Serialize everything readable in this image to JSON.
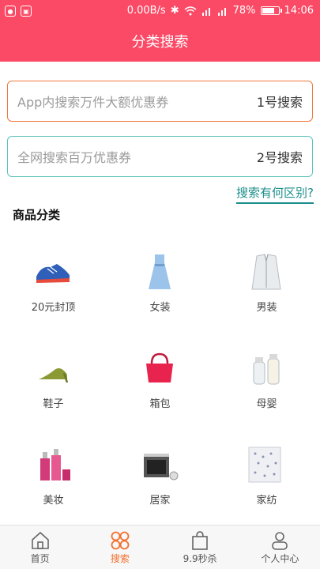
{
  "status_bar": {
    "network_speed": "0.00B/s",
    "battery": "78%",
    "battery_level": 0.78,
    "time": "14:06"
  },
  "header": {
    "title": "分类搜索"
  },
  "search": [
    {
      "placeholder": "App内搜索万件大额优惠券",
      "button": "1号搜索"
    },
    {
      "placeholder": "全网搜索百万优惠券",
      "button": "2号搜索"
    }
  ],
  "diff_link": "搜索有何区别?",
  "categories_title": "商品分类",
  "categories": [
    {
      "label": "20元封顶",
      "icon": "sneaker-icon"
    },
    {
      "label": "女装",
      "icon": "dress-icon"
    },
    {
      "label": "男装",
      "icon": "suit-icon"
    },
    {
      "label": "鞋子",
      "icon": "high-heel-icon"
    },
    {
      "label": "箱包",
      "icon": "handbag-icon"
    },
    {
      "label": "母婴",
      "icon": "baby-bottle-icon"
    },
    {
      "label": "美妆",
      "icon": "cosmetics-icon"
    },
    {
      "label": "居家",
      "icon": "appliance-icon"
    },
    {
      "label": "家纺",
      "icon": "bedding-icon"
    }
  ],
  "tabs": [
    {
      "label": "首页",
      "icon": "home-icon"
    },
    {
      "label": "搜索",
      "icon": "search-grid-icon"
    },
    {
      "label": "9.9秒杀",
      "icon": "shopping-bag-icon"
    },
    {
      "label": "个人中心",
      "icon": "person-icon"
    }
  ],
  "colors": {
    "brand": "#fb4a66",
    "accent": "#f2702e",
    "teal": "#1a8e8a"
  }
}
